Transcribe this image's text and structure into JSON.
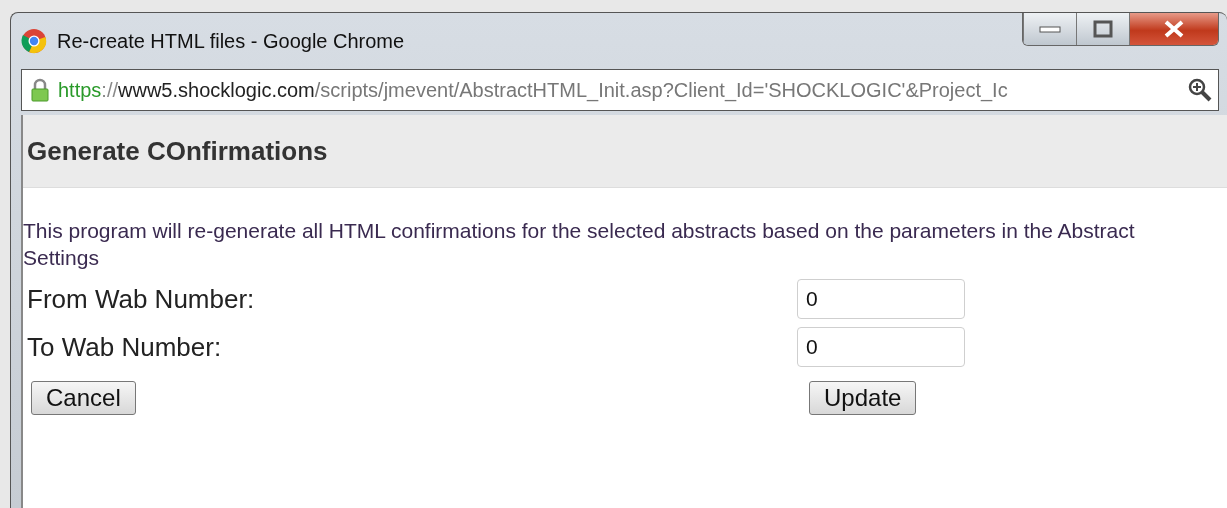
{
  "window": {
    "title": "Re-create HTML files - Google Chrome"
  },
  "address_bar": {
    "scheme": "https",
    "separator": "://",
    "host": "www5.shocklogic.com",
    "path": "/scripts/jmevent/AbstractHTML_Init.asp?Client_Id='SHOCKLOGIC'&Project_Ic"
  },
  "page": {
    "heading": "Generate COnfirmations",
    "description": "This program will re-generate all HTML confirmations for the selected abstracts based on the parameters in the Abstract Settings",
    "fields": [
      {
        "label": "From Wab Number:",
        "value": "0"
      },
      {
        "label": "To Wab Number:",
        "value": "0"
      }
    ],
    "buttons": [
      "Cancel",
      "Update"
    ]
  }
}
